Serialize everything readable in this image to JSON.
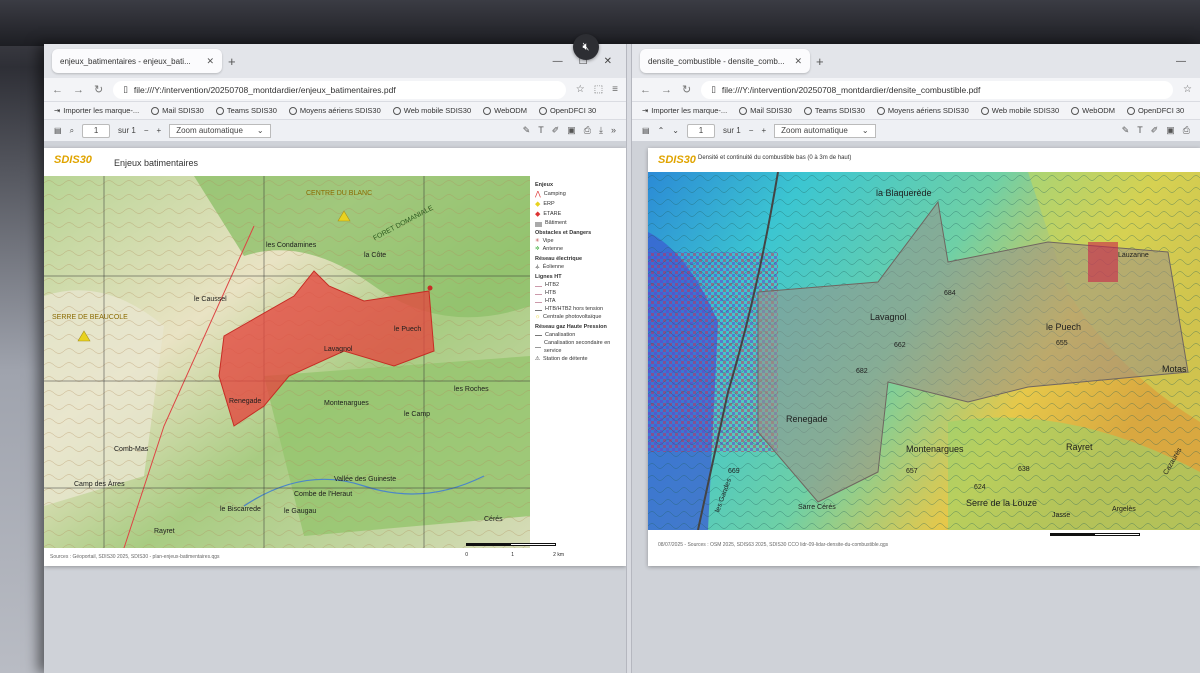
{
  "left": {
    "tab_title": "enjeux_batimentaires - enjeux_bati...",
    "url": "file:///Y:/intervention/20250708_montdardier/enjeux_batimentaires.pdf",
    "bookmarks": [
      "Importer les marque-...",
      "Mail SDIS30",
      "Teams SDIS30",
      "Moyens aériens SDIS30",
      "Web mobile SDIS30",
      "WebODM",
      "OpenDFCI 30"
    ],
    "page_number": "1",
    "page_total": "sur 1",
    "zoom": "Zoom automatique",
    "doc_logo": "SDIS",
    "doc_logo_num": "30",
    "doc_title": "Enjeux batimentaires",
    "legend": {
      "title": "Enjeux",
      "items": [
        "Camping",
        "ERP",
        "ETARE",
        "Bâtiment"
      ],
      "sec2": "Obstacles et Dangers",
      "items2": [
        "Vipe",
        "Antenne"
      ],
      "sec3": "Réseau électrique",
      "items3": [
        "Éolienne"
      ],
      "sec4": "Lignes HT",
      "items4": [
        "HTB2",
        "HTB",
        "HTA",
        "HTB/HTB2 hors tension",
        "Centrale photovoltaïque"
      ],
      "sec5": "Réseau gaz Haute Pression",
      "items5": [
        "Canalisation",
        "Canalisation secondaire en service",
        "Station de détente"
      ]
    },
    "map_labels": [
      "FORET DOMANIALE",
      "le Caussel",
      "les Condamines",
      "la Côte",
      "Lavagnol",
      "le Puech",
      "Renegade",
      "Montenargues",
      "le Camp",
      "les Roches",
      "Comb-Mas",
      "Camp des Àrres",
      "le Biscarrede",
      "Rayret",
      "le Gaugau",
      "Cérés",
      "Vallée des Guineste",
      "Combe de l'Heraut",
      "CENTRE DU BLANC",
      "SERRE DE BEAUCOLE"
    ],
    "scale_labels": [
      "0",
      "1",
      "2 km"
    ],
    "credit": "Sources : Géoportail, SDIS30 2025, SDIS30 - plan-enjeux-batimentaires.qgs"
  },
  "right": {
    "tab_title": "densite_combustible - densite_comb...",
    "url": "file:///Y:/intervention/20250708_montdardier/densite_combustible.pdf",
    "bookmarks": [
      "Importer les marque-...",
      "Mail SDIS30",
      "Teams SDIS30",
      "Moyens aériens SDIS30",
      "Web mobile SDIS30",
      "WebODM",
      "OpenDFCI 30"
    ],
    "page_number": "1",
    "page_total": "sur 1",
    "zoom": "Zoom automatique",
    "doc_logo": "SDIS",
    "doc_logo_num": "30",
    "doc_title": "Densité et continuité du combustible bas (0 à 3m de haut)",
    "map_labels": [
      "la Blaquerède",
      "Lavagnol",
      "le Puech",
      "Renegade",
      "Montenargues",
      "Serre de la Louze",
      "Rayret",
      "Motas",
      "Jasse",
      "Argelès",
      "Lauzanne",
      "Cazaurès",
      "Sarre Cérés",
      "les Gandes"
    ],
    "elevations": [
      "684",
      "682",
      "655",
      "662",
      "669",
      "624",
      "657",
      "638"
    ],
    "credit": "08/07/2025 - Sources : OSM 2025, SDIS63 2025, SDIS30 CCO lidr-09-lidar-densite-du-combustible.qgs"
  },
  "colors": {
    "intervention_zone": "#e4473f",
    "topo_green": "#9fc77a",
    "fuel_cyan": "#3cc6d1",
    "fuel_yellow": "#e6c84a"
  }
}
